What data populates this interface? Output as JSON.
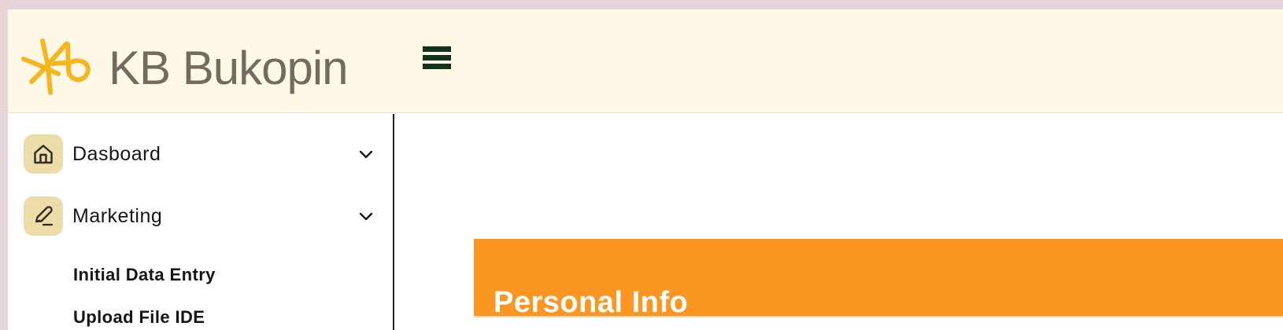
{
  "brand": {
    "name": "KB Bukopin",
    "logo_icon": "kb-star-logo",
    "logo_color": "#f5b51d",
    "text_color": "#746b60"
  },
  "header": {
    "menu_toggle_icon": "hamburger-menu-icon"
  },
  "sidebar": {
    "items": [
      {
        "label": "Dasboard",
        "icon": "home-icon",
        "chevron": "chevron-down-icon"
      },
      {
        "label": "Marketing",
        "icon": "pen-icon",
        "chevron": "chevron-down-icon",
        "subitems": [
          {
            "label": "Initial Data Entry"
          },
          {
            "label": "Upload File IDE"
          }
        ]
      }
    ],
    "icon_background": "#ecdca8"
  },
  "main": {
    "panel": {
      "title": "Personal Info",
      "header_color": "#fb9622"
    }
  },
  "colors": {
    "page_background": "#e6d4d7",
    "header_background": "#fff8e6",
    "menu_toggle_color": "#11321b"
  }
}
